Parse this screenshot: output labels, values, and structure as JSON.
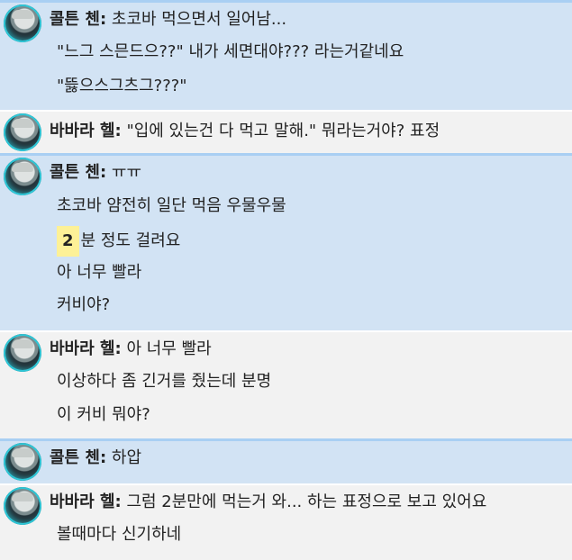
{
  "messages": [
    {
      "author": "콜튼 첸:",
      "first_text": " 초코바 먹으면서 일어남...",
      "continuation": [
        "\"느그 스믄드으??\" 내가 세면대야??? 라는거같네요",
        "\"뜷으스그츠그???\""
      ]
    },
    {
      "author": "바바라 헬:",
      "first_text": " \"입에 있는건 다 먹고 말해.\" 뭐라는거야? 표정",
      "continuation": []
    },
    {
      "author": "콜튼 첸:",
      "first_text": " ㅠㅠ",
      "continuation": [
        "초코바 얌전히 일단 먹음 우물우물",
        "아 너무 빨라",
        "커비야?"
      ],
      "highlight_line": {
        "badge": "2",
        "text": "분 정도 걸려요"
      }
    },
    {
      "author": "바바라 헬:",
      "first_text": " 아 너무 빨라",
      "continuation": [
        "이상하다 좀 긴거를 줬는데 분명",
        "이 커비 뭐야?"
      ]
    },
    {
      "author": "콜튼 첸:",
      "first_text": " 하압",
      "continuation": []
    },
    {
      "author": "바바라 헬:",
      "first_text": " 그럼 2분만에 먹는거 와... 하는 표정으로 보고 있어요",
      "continuation": [
        "볼때마다 신기하네"
      ]
    }
  ]
}
